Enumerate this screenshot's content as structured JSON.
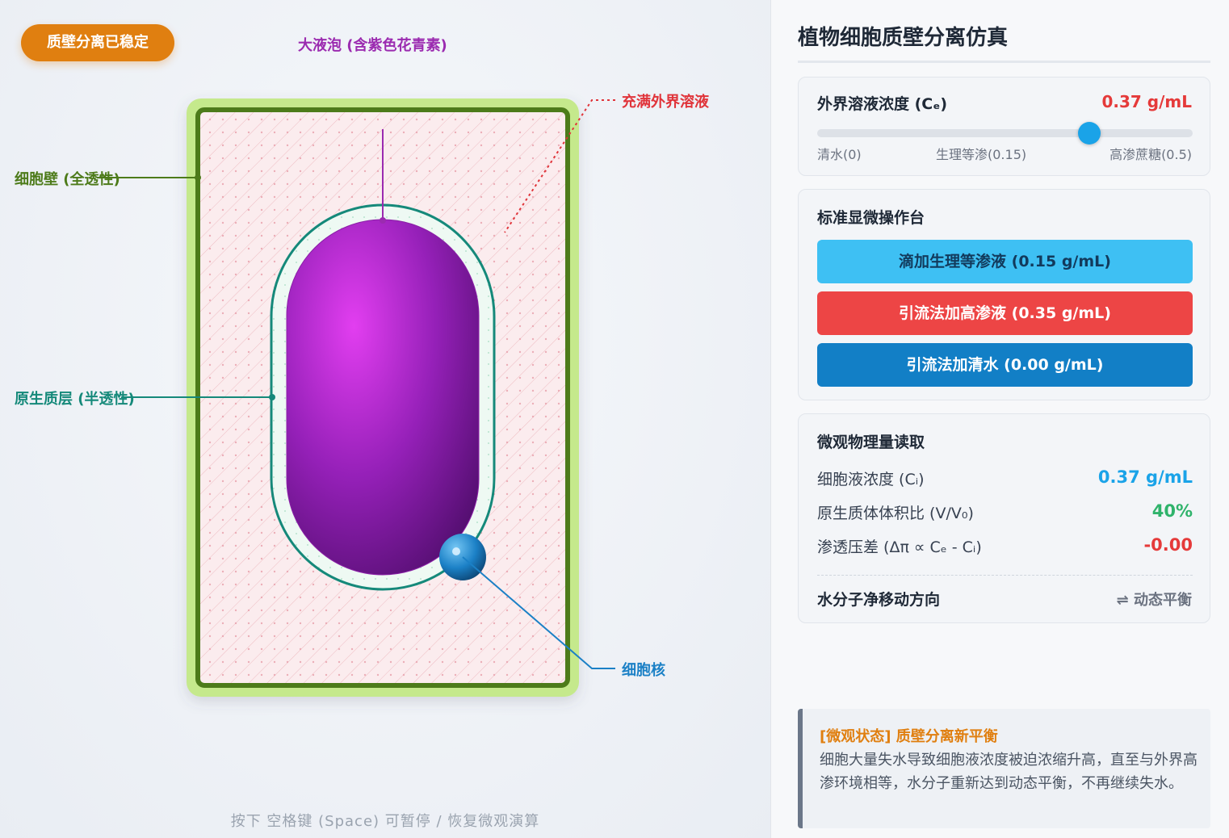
{
  "stage": {
    "status_badge": "质壁分离已稳定",
    "labels": {
      "vacuole": "大液泡 (含紫色花青素)",
      "solution": "充满外界溶液",
      "wall": "细胞壁 (全透性)",
      "membrane": "原生质层 (半透性)",
      "nucleus": "细胞核"
    },
    "hint": "按下 空格键 (Space) 可暂停 / 恢复微观演算"
  },
  "panel": {
    "title": "植物细胞质壁分离仿真",
    "concentration": {
      "label": "外界溶液浓度 (Cₑ)",
      "value": "0.37 g/mL",
      "slider_fraction": 0.74,
      "ticks": [
        "清水(0)",
        "生理等渗(0.15)",
        "高渗蔗糖(0.5)"
      ]
    },
    "ops": {
      "title": "标准显微操作台",
      "buttons": [
        "滴加生理等渗液 (0.15 g/mL)",
        "引流法加高渗液 (0.35 g/mL)",
        "引流法加清水 (0.00 g/mL)"
      ]
    },
    "readings": {
      "title": "微观物理量读取",
      "rows": [
        {
          "label": "细胞液浓度 (Cᵢ)",
          "value": "0.37 g/mL"
        },
        {
          "label": "原生质体体积比 (V/V₀)",
          "value": "40%"
        },
        {
          "label": "渗透压差 (Δπ ∝ Cₑ - Cᵢ)",
          "value": "-0.00"
        }
      ],
      "water_label": "水分子净移动方向",
      "water_value": "⇌ 动态平衡"
    },
    "note": {
      "title": "[微观状态] 质壁分离新平衡",
      "body": "细胞大量失水导致细胞液浓度被迫浓缩升高，直至与外界高渗环境相等，水分子重新达到动态平衡，不再继续失水。"
    }
  },
  "colors": {
    "badge": "#e07f10",
    "vacuole": "#9b2bb0",
    "wall": "#4d7b1a",
    "membrane": "#15897a",
    "nucleus": "#1b80c6",
    "high": "#ed4545",
    "iso": "#3ec0f3",
    "water": "#127fc6",
    "positive": "#2fb36b"
  }
}
